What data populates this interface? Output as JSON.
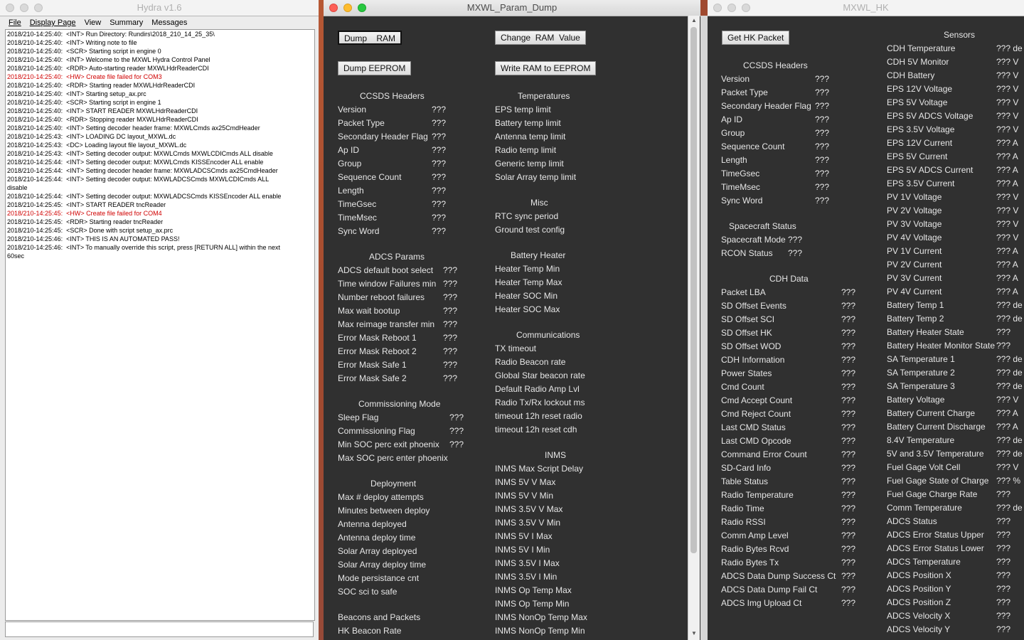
{
  "hydra": {
    "title": "Hydra v1.6",
    "menu": [
      "File",
      "Display Page",
      "View",
      "Summary",
      "Messages"
    ],
    "log": [
      {
        "t": "2018/210-14:25:40:  <INT> Run Directory: Rundirs\\2018_210_14_25_35\\",
        "err": false
      },
      {
        "t": "2018/210-14:25:40:  <INT> Writing note to file",
        "err": false
      },
      {
        "t": "2018/210-14:25:40:  <SCR> Starting script in engine 0",
        "err": false
      },
      {
        "t": "2018/210-14:25:40:  <INT> Welcome to the MXWL Hydra Control Panel",
        "err": false
      },
      {
        "t": "2018/210-14:25:40:  <RDR> Auto-starting reader MXWLHdrReaderCDI",
        "err": false
      },
      {
        "t": "2018/210-14:25:40:  <HW> Create file failed for COM3",
        "err": true
      },
      {
        "t": "2018/210-14:25:40:  <RDR> Starting reader MXWLHdrReaderCDI",
        "err": false
      },
      {
        "t": "2018/210-14:25:40:  <INT> Starting setup_ax.prc",
        "err": false
      },
      {
        "t": "2018/210-14:25:40:  <SCR> Starting script in engine 1",
        "err": false
      },
      {
        "t": "2018/210-14:25:40:  <INT> START READER MXWLHdrReaderCDI",
        "err": false
      },
      {
        "t": "2018/210-14:25:40:  <RDR> Stopping reader MXWLHdrReaderCDI",
        "err": false
      },
      {
        "t": "2018/210-14:25:40:  <INT> Setting decoder header frame: MXWLCmds ax25CmdHeader",
        "err": false
      },
      {
        "t": "2018/210-14:25:43:  <INT> LOADING DC layout_MXWL.dc",
        "err": false
      },
      {
        "t": "2018/210-14:25:43:  <DC> Loading layout file layout_MXWL.dc",
        "err": false
      },
      {
        "t": "2018/210-14:25:43:  <INT> Setting decoder output: MXWLCmds MXWLCDICmds ALL disable",
        "err": false
      },
      {
        "t": "2018/210-14:25:44:  <INT> Setting decoder output: MXWLCmds KISSEncoder ALL enable",
        "err": false
      },
      {
        "t": "2018/210-14:25:44:  <INT> Setting decoder header frame: MXWLADCSCmds ax25CmdHeader",
        "err": false
      },
      {
        "t": "2018/210-14:25:44:  <INT> Setting decoder output: MXWLADCSCmds MXWLCDICmds ALL\ndisable",
        "err": false
      },
      {
        "t": "2018/210-14:25:44:  <INT> Setting decoder output: MXWLADCSCmds KISSEncoder ALL enable",
        "err": false
      },
      {
        "t": "2018/210-14:25:45:  <INT> START READER tncReader",
        "err": false
      },
      {
        "t": "2018/210-14:25:45:  <HW> Create file failed for COM4",
        "err": true
      },
      {
        "t": "2018/210-14:25:45:  <RDR> Starting reader tncReader",
        "err": false
      },
      {
        "t": "2018/210-14:25:45:  <SCR> Done with script setup_ax.prc",
        "err": false
      },
      {
        "t": "2018/210-14:25:46:  <INT> THIS IS AN AUTOMATED PASS!",
        "err": false
      },
      {
        "t": "2018/210-14:25:46:  <INT> To manually override this script, press [RETURN ALL] within the next\n60sec",
        "err": false
      }
    ]
  },
  "param": {
    "title": "MXWL_Param_Dump",
    "buttons": {
      "dump_ram": "Dump    RAM",
      "change_ram": "Change  RAM  Value",
      "dump_eeprom": "Dump EEPROM",
      "write_ram": "Write RAM to EEPROM"
    },
    "left": {
      "ccsds": {
        "title": "CCSDS Headers",
        "items": [
          [
            "Version",
            "???"
          ],
          [
            "Packet Type",
            "???"
          ],
          [
            "Secondary Header Flag",
            "???"
          ],
          [
            "Ap ID",
            "???"
          ],
          [
            "Group",
            "???"
          ],
          [
            "Sequence Count",
            "???"
          ],
          [
            "Length",
            "???"
          ],
          [
            "TimeGsec",
            "???"
          ],
          [
            "TimeMsec",
            "???"
          ],
          [
            "Sync Word",
            "???"
          ]
        ]
      },
      "adcs": {
        "title": "ADCS Params",
        "items": [
          [
            "ADCS default boot select",
            "???"
          ],
          [
            "Time window Failures min",
            "???"
          ],
          [
            "Number reboot failures",
            "???"
          ],
          [
            "Max wait bootup",
            "???"
          ],
          [
            "Max reimage transfer min",
            "???"
          ],
          [
            "Error Mask Reboot 1",
            "???"
          ],
          [
            "Error Mask Reboot 2",
            "???"
          ],
          [
            "Error Mask Safe 1",
            "???"
          ],
          [
            "Error Mask Safe 2",
            "???"
          ]
        ]
      },
      "comm": {
        "title": "Commissioning Mode",
        "items": [
          [
            "Sleep Flag",
            "???"
          ],
          [
            "Commissioning Flag",
            "???"
          ],
          [
            "Min SOC perc exit phoenix",
            "???"
          ],
          [
            "Max SOC perc enter phoenix",
            ""
          ]
        ]
      },
      "deploy": {
        "title": "Deployment",
        "items": [
          "Max # deploy attempts",
          "Minutes between deploy",
          "Antenna deployed",
          "Antenna deploy time",
          "Solar Array deployed",
          "Solar Array deploy time",
          "Mode persistance cnt",
          "SOC sci to safe"
        ]
      },
      "beacons": {
        "title": "Beacons and Packets",
        "items": [
          "HK Beacon Rate"
        ]
      }
    },
    "right": {
      "temps": {
        "title": "Temperatures",
        "items": [
          "EPS temp limit",
          "Battery temp limit",
          "Antenna temp limit",
          "Radio temp limit",
          "Generic temp limit",
          "Solar Array temp limit"
        ]
      },
      "misc": {
        "title": "Misc",
        "items": [
          "RTC sync period",
          "Ground test config"
        ]
      },
      "battery": {
        "title": "Battery Heater",
        "items": [
          "Heater Temp Min",
          "Heater Temp Max",
          "Heater SOC Min",
          "Heater SOC Max"
        ]
      },
      "comms": {
        "title": "Communications",
        "items": [
          "TX timeout",
          "Radio Beacon rate",
          "Global Star beacon rate",
          "Default Radio Amp Lvl",
          "Radio Tx/Rx lockout ms",
          "timeout 12h reset radio",
          "timeout 12h reset cdh"
        ]
      },
      "inms": {
        "title": "INMS",
        "items": [
          "INMS Max Script Delay",
          "INMS 5V V Max",
          "INMS 5V V Min",
          "INMS 3.5V V Max",
          "INMS 3.5V V Min",
          "INMS 5V I Max",
          "INMS 5V I Min",
          "INMS 3.5V I Max",
          "INMS 3.5V I Min",
          "INMS Op Temp Max",
          "INMS Op Temp Min",
          "INMS NonOp Temp Max",
          "INMS NonOp Temp Min"
        ]
      }
    }
  },
  "hk": {
    "title": "MXWL_HK",
    "button": "Get HK Packet",
    "ccsds": {
      "title": "CCSDS Headers",
      "items": [
        [
          "Version",
          "???"
        ],
        [
          "Packet Type",
          "???"
        ],
        [
          "Secondary Header Flag",
          "???"
        ],
        [
          "Ap ID",
          "???"
        ],
        [
          "Group",
          "???"
        ],
        [
          "Sequence Count",
          "???"
        ],
        [
          "Length",
          "???"
        ],
        [
          "TimeGsec",
          "???"
        ],
        [
          "TimeMsec",
          "???"
        ],
        [
          "Sync Word",
          "???"
        ]
      ]
    },
    "sc": {
      "title": "Spacecraft Status",
      "items": [
        [
          "Spacecraft Mode",
          "???"
        ],
        [
          "RCON Status",
          "???"
        ]
      ]
    },
    "cdh": {
      "title": "CDH Data",
      "items": [
        [
          "Packet LBA",
          "???"
        ],
        [
          "SD Offset Events",
          "???"
        ],
        [
          "SD Offset SCI",
          "???"
        ],
        [
          "SD Offset HK",
          "???"
        ],
        [
          "SD Offset WOD",
          "???"
        ],
        [
          "CDH Information",
          "???"
        ],
        [
          "Power States",
          "???"
        ],
        [
          "Cmd Count",
          "???"
        ],
        [
          "Cmd Accept Count",
          "???"
        ],
        [
          "Cmd Reject Count",
          "???"
        ],
        [
          "Last CMD Status",
          "???"
        ],
        [
          "Last CMD Opcode",
          "???"
        ],
        [
          "Command Error Count",
          "???"
        ],
        [
          "SD-Card Info",
          "???"
        ],
        [
          "Table Status",
          "???"
        ],
        [
          "Radio Temperature",
          "???"
        ],
        [
          "Radio Time",
          "???"
        ],
        [
          "Radio RSSI",
          "???"
        ],
        [
          "Comm Amp Level",
          "???"
        ],
        [
          "Radio Bytes Rcvd",
          "???"
        ],
        [
          "Radio Bytes Tx",
          "???"
        ],
        [
          "ADCS Data Dump Success Ct",
          "???"
        ],
        [
          "ADCS Data Dump Fail Ct",
          "???"
        ],
        [
          "ADCS Img Upload Ct",
          "???"
        ]
      ]
    },
    "sensors": {
      "title": "Sensors",
      "items": [
        [
          "CDH Temperature",
          "??? de"
        ],
        [
          "CDH 5V Monitor",
          "??? V"
        ],
        [
          "CDH Battery",
          "??? V"
        ],
        [
          "EPS 12V Voltage",
          "??? V"
        ],
        [
          "EPS 5V Voltage",
          "??? V"
        ],
        [
          "EPS 5V ADCS Voltage",
          "??? V"
        ],
        [
          "EPS 3.5V Voltage",
          "??? V"
        ],
        [
          "EPS 12V Current",
          "??? A"
        ],
        [
          "EPS 5V Current",
          "??? A"
        ],
        [
          "EPS 5V ADCS Current",
          "??? A"
        ],
        [
          "EPS 3.5V Current",
          "??? A"
        ],
        [
          "PV 1V Voltage",
          "??? V"
        ],
        [
          "PV 2V Voltage",
          "??? V"
        ],
        [
          "PV 3V Voltage",
          "??? V"
        ],
        [
          "PV 4V Voltage",
          "??? V"
        ],
        [
          "PV 1V Current",
          "??? A"
        ],
        [
          "PV 2V Current",
          "??? A"
        ],
        [
          "PV 3V Current",
          "??? A"
        ],
        [
          "PV 4V Current",
          "??? A"
        ],
        [
          "Battery Temp 1",
          "??? de"
        ],
        [
          "Battery Temp 2",
          "??? de"
        ],
        [
          "Battery Heater State",
          "???"
        ],
        [
          "Battery Heater Monitor State",
          "???"
        ],
        [
          "SA Temperature 1",
          "??? de"
        ],
        [
          "SA Temperature 2",
          "??? de"
        ],
        [
          "SA Temperature 3",
          "??? de"
        ],
        [
          "Battery Voltage",
          "??? V"
        ],
        [
          "Battery Current Charge",
          "??? A"
        ],
        [
          "Battery Current Discharge",
          "??? A"
        ],
        [
          "8.4V Temperature",
          "??? de"
        ],
        [
          "5V and 3.5V Temperature",
          "??? de"
        ],
        [
          "Fuel Gage Volt Cell",
          "??? V"
        ],
        [
          "Fuel Gage State of Charge",
          "??? %"
        ],
        [
          "Fuel Gage Charge Rate",
          "???"
        ],
        [
          "Comm Temperature",
          "??? de"
        ],
        [
          "ADCS Status",
          "???"
        ],
        [
          "ADCS Error Status Upper",
          "???"
        ],
        [
          "ADCS Error Status Lower",
          "???"
        ],
        [
          "ADCS Temperature",
          "???"
        ],
        [
          "ADCS Position X",
          "???"
        ],
        [
          "ADCS Position Y",
          "???"
        ],
        [
          "ADCS Position Z",
          "???"
        ],
        [
          "ADCS Velocity X",
          "???"
        ],
        [
          "ADCS Velocity Y",
          "???"
        ]
      ]
    }
  }
}
